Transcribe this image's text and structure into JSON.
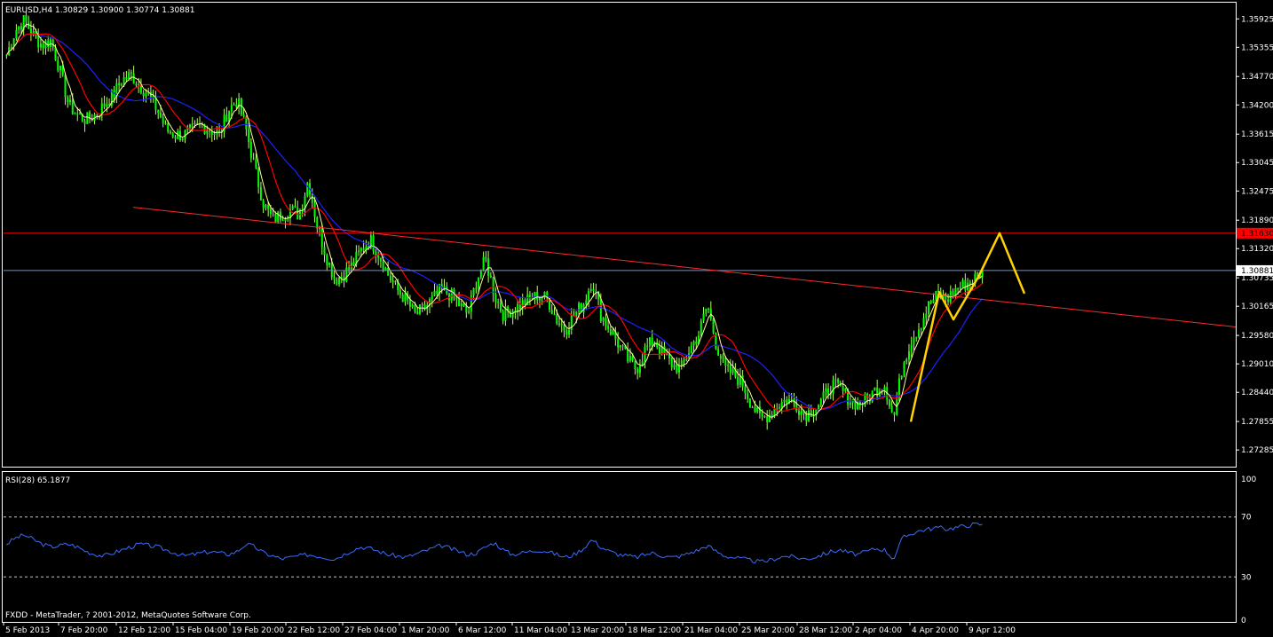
{
  "window": {
    "header": "EURUSD,H4  1.30829 1.30900 1.30774 1.30881",
    "footer": "FXDD - MetaTrader, ? 2001-2012, MetaQuotes Software Corp."
  },
  "colors": {
    "background": "#000000",
    "frame": "#ffffff",
    "candle": "#00ff00",
    "wick": "#b4ff60",
    "ma_fast": "#ffff99",
    "ma_mid": "#ff0000",
    "ma_slow": "#2020ff",
    "trendline": "#ff2a2a",
    "resistance_line": "#ff0000",
    "price_line": "#7f8fb0",
    "resistance_tag_bg": "#ff0000",
    "price_tag_bg": "#ffffff",
    "pattern": "#ffd200",
    "rsi_line": "#3a6cff",
    "rsi_levels": "#c8c8c8"
  },
  "chart_data": [
    {
      "type": "candlestick",
      "symbol": "EURUSD",
      "timeframe": "H4",
      "ohlc": {
        "open": 1.30829,
        "high": 1.309,
        "low": 1.30774,
        "close": 1.30881
      },
      "ylim": [
        1.2695,
        1.3625
      ],
      "y_ticks": [
        "1.35925",
        "1.35355",
        "1.34770",
        "1.34200",
        "1.33615",
        "1.33045",
        "1.32475",
        "1.31890",
        "1.31320",
        "1.30735",
        "1.30165",
        "1.29580",
        "1.29010",
        "1.28440",
        "1.27855",
        "1.27285"
      ],
      "price_tags": {
        "resistance": "1.31630",
        "current": "1.30881"
      },
      "resistance_level": 1.3163,
      "current_price": 1.30881,
      "x_labels": [
        "5 Feb 2013",
        "7 Feb 20:00",
        "12 Feb 12:00",
        "15 Feb 04:00",
        "19 Feb 20:00",
        "22 Feb 12:00",
        "27 Feb 04:00",
        "1 Mar 20:00",
        "6 Mar 12:00",
        "11 Mar 04:00",
        "13 Mar 20:00",
        "18 Mar 12:00",
        "21 Mar 04:00",
        "25 Mar 20:00",
        "28 Mar 12:00",
        "2 Apr 04:00",
        "4 Apr 20:00",
        "9 Apr 12:00"
      ],
      "close_path": [
        1.352,
        1.357,
        1.359,
        1.356,
        1.354,
        1.355,
        1.349,
        1.342,
        1.34,
        1.339,
        1.34,
        1.342,
        1.344,
        1.347,
        1.348,
        1.346,
        1.344,
        1.341,
        1.337,
        1.336,
        1.336,
        1.337,
        1.338,
        1.337,
        1.336,
        1.341,
        1.343,
        1.337,
        1.329,
        1.322,
        1.319,
        1.32,
        1.321,
        1.32,
        1.327,
        1.318,
        1.312,
        1.307,
        1.308,
        1.31,
        1.313,
        1.315,
        1.312,
        1.308,
        1.305,
        1.303,
        1.3,
        1.301,
        1.303,
        1.305,
        1.304,
        1.302,
        1.3,
        1.307,
        1.311,
        1.304,
        1.3,
        1.301,
        1.302,
        1.303,
        1.304,
        1.303,
        1.299,
        1.297,
        1.3,
        1.302,
        1.307,
        1.3,
        1.297,
        1.294,
        1.291,
        1.289,
        1.293,
        1.295,
        1.292,
        1.29,
        1.289,
        1.293,
        1.296,
        1.302,
        1.294,
        1.289,
        1.288,
        1.286,
        1.282,
        1.279,
        1.28,
        1.282,
        1.283,
        1.282,
        1.28,
        1.281,
        1.283,
        1.286,
        1.285,
        1.283,
        1.282,
        1.283,
        1.285,
        1.286,
        1.279,
        1.29,
        1.295,
        1.298,
        1.302,
        1.304,
        1.303,
        1.305,
        1.306,
        1.307,
        1.3088
      ],
      "pattern_points": [
        {
          "x": 1,
          "y": 1.2785
        },
        {
          "x": 9,
          "y": 1.3045
        },
        {
          "x": 13,
          "y": 1.299
        },
        {
          "x": 20,
          "y": 1.3075
        },
        {
          "x": 26,
          "y": 1.3163
        },
        {
          "x": 33,
          "y": 1.3042
        }
      ]
    },
    {
      "type": "line",
      "label": "RSI(28) 65.1877",
      "ylim": [
        0,
        100
      ],
      "y_ticks": [
        "100",
        "70",
        "30",
        "0"
      ],
      "levels": [
        70,
        30
      ],
      "values": [
        52,
        56,
        58,
        55,
        52,
        50,
        51,
        52,
        50,
        47,
        45,
        44,
        46,
        48,
        50,
        52,
        51,
        50,
        48,
        46,
        44,
        45,
        46,
        47,
        46,
        45,
        47,
        52,
        50,
        46,
        44,
        42,
        43,
        44,
        45,
        44,
        43,
        42,
        45,
        48,
        50,
        49,
        47,
        45,
        44,
        43,
        45,
        47,
        49,
        51,
        49,
        47,
        45,
        46,
        50,
        53,
        48,
        45,
        46,
        47,
        48,
        47,
        45,
        43,
        45,
        49,
        55,
        50,
        47,
        45,
        44,
        43,
        45,
        46,
        44,
        43,
        44,
        46,
        48,
        51,
        47,
        44,
        43,
        42,
        41,
        40,
        41,
        43,
        44,
        43,
        42,
        43,
        45,
        47,
        48,
        46,
        45,
        47,
        49,
        48,
        42,
        56,
        59,
        61,
        62,
        63,
        62,
        63,
        64,
        65,
        65.19
      ]
    }
  ]
}
